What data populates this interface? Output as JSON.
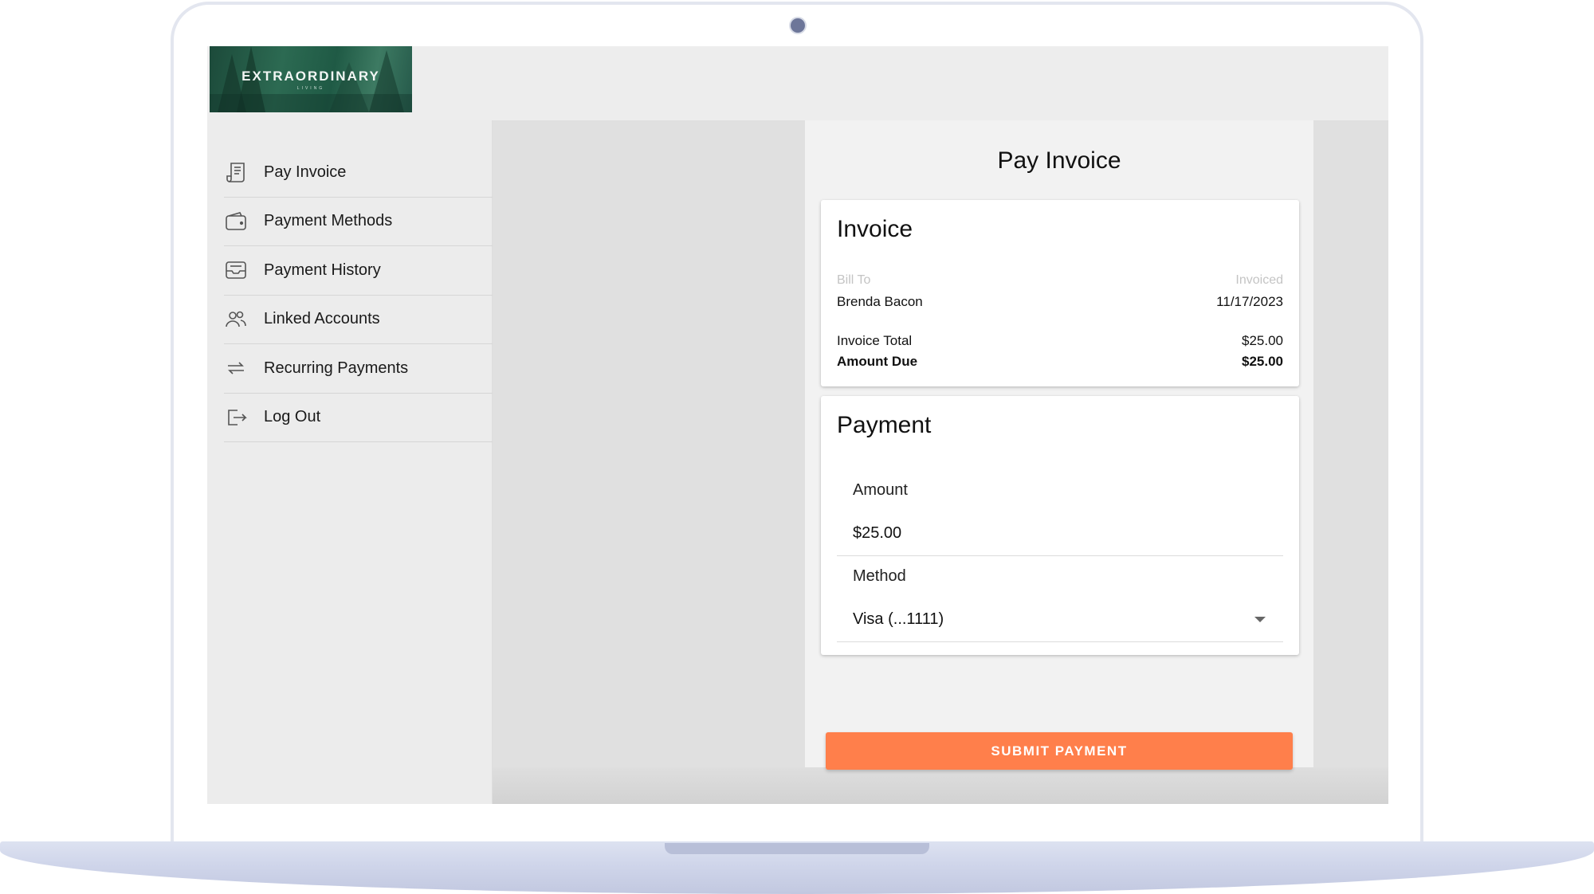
{
  "brand": {
    "logo_text": "EXTRAORDINARY",
    "logo_subtext": "LIVING"
  },
  "sidebar": {
    "items": [
      {
        "label": "Pay Invoice",
        "icon": "receipt-icon"
      },
      {
        "label": "Payment Methods",
        "icon": "wallet-icon"
      },
      {
        "label": "Payment History",
        "icon": "inbox-icon"
      },
      {
        "label": "Linked Accounts",
        "icon": "users-icon"
      },
      {
        "label": "Recurring Payments",
        "icon": "repeat-icon"
      },
      {
        "label": "Log Out",
        "icon": "logout-icon"
      }
    ]
  },
  "page": {
    "title": "Pay Invoice"
  },
  "invoice": {
    "title": "Invoice",
    "bill_to_label": "Bill To",
    "invoiced_label": "Invoiced",
    "bill_to_name": "Brenda Bacon",
    "invoiced_date": "11/17/2023",
    "total_label": "Invoice Total",
    "total_value": "$25.00",
    "due_label": "Amount Due",
    "due_value": "$25.00"
  },
  "payment": {
    "title": "Payment",
    "amount_label": "Amount",
    "amount_value": "$25.00",
    "method_label": "Method",
    "method_value": "Visa (...1111)"
  },
  "actions": {
    "submit_label": "SUBMIT PAYMENT"
  },
  "colors": {
    "accent": "#ff7f4b",
    "brand_green": "#2c6a52"
  }
}
